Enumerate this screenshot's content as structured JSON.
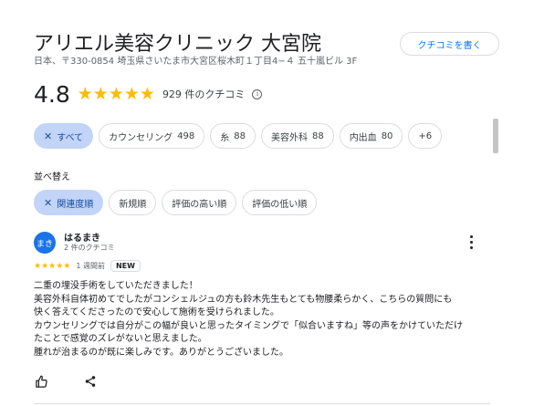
{
  "place": {
    "title": "アリエル美容クリニック 大宮院",
    "address": "日本、〒330-0854 埼玉県さいたま市大宮区桜木町１丁目4−４ 五十嵐ビル 3F",
    "write_review_label": "クチコミを書く"
  },
  "rating": {
    "value": "4.8",
    "stars": "★★★★★",
    "count_label": "929 件のクチコミ",
    "info_glyph": "i"
  },
  "filters": {
    "chips": [
      {
        "label": "すべて",
        "count": "",
        "selected": true
      },
      {
        "label": "カウンセリング",
        "count": "498"
      },
      {
        "label": "糸",
        "count": "88"
      },
      {
        "label": "美容外科",
        "count": "88"
      },
      {
        "label": "内出血",
        "count": "80"
      },
      {
        "label": "+6",
        "count": ""
      }
    ]
  },
  "sort": {
    "label": "並べ替え",
    "options": [
      {
        "label": "関連度順",
        "selected": true
      },
      {
        "label": "新規順"
      },
      {
        "label": "評価の高い順"
      },
      {
        "label": "評価の低い順"
      }
    ]
  },
  "review": {
    "avatar_text": "まき",
    "author": "はるまき",
    "author_sub": "2 件のクチコミ",
    "stars": "★★★★★",
    "date": "1 週間前",
    "badge": "NEW",
    "lines": [
      "二重の埋没手術をしていただきました！",
      "美容外科自体初めてでしたがコンシェルジュの方も鈴木先生もとても物腰柔らかく、こちらの質問にも",
      "快く答えてくださったので安心して施術を受けられました。",
      "カウンセリングでは自分がこの幅が良いと思ったタイミングで「似合いますね」等の声をかけていただけ",
      "たことで感覚のズレがないと思えました。",
      "腫れが治まるのが既に楽しみです。ありがとうございました。"
    ]
  },
  "icons": {
    "close": "close-icon",
    "like": "thumb-up-icon",
    "share": "share-icon",
    "more": "more-vert-icon",
    "info": "info-icon"
  },
  "colors": {
    "accent": "#1a73e8",
    "star": "#fbbc04",
    "chip_selected_bg": "#c2d4f7"
  }
}
